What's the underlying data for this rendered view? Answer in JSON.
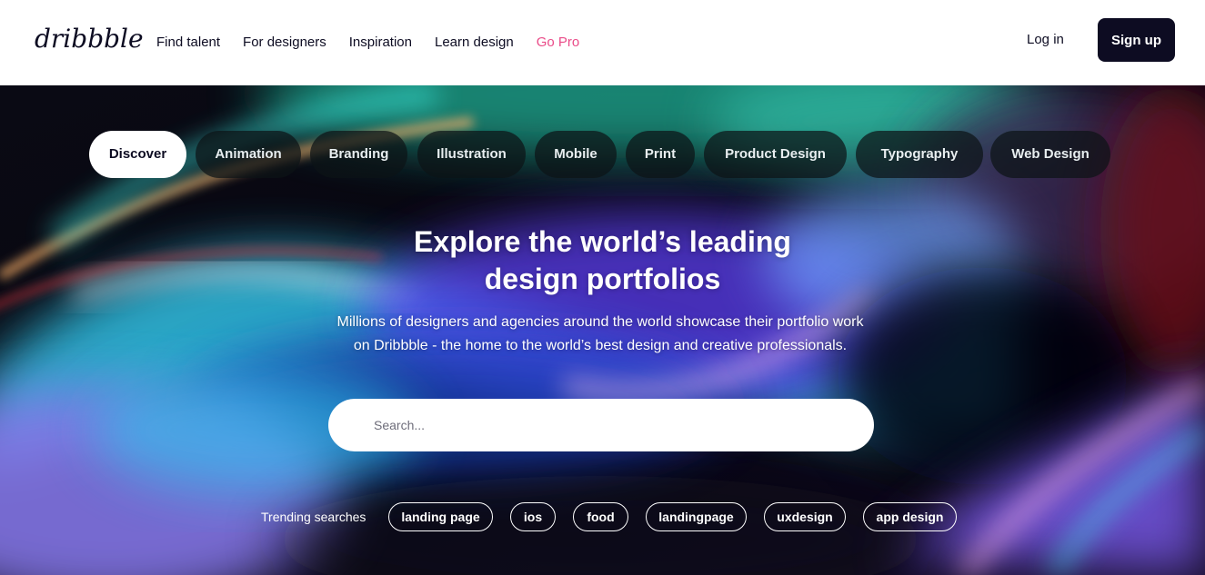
{
  "header": {
    "logo": "dribbble",
    "nav": [
      "Find talent",
      "For designers",
      "Inspiration",
      "Learn design",
      "Go Pro"
    ],
    "login_label": "Log in",
    "signup_label": "Sign up"
  },
  "hero": {
    "categories": [
      "Discover",
      "Animation",
      "Branding",
      "Illustration",
      "Mobile",
      "Print",
      "Product Design",
      "Typography",
      "Web Design"
    ],
    "active_category": "Discover",
    "headline_line1": "Explore the world’s leading",
    "headline_line2": "design portfolios",
    "subtext_line1": "Millions of designers and agencies around the world showcase their portfolio work",
    "subtext_line2": "on Dribbble - the home to the world’s best design and creative professionals.",
    "search_placeholder": "Search...",
    "trending_label": "Trending searches",
    "trending": [
      "landing page",
      "ios",
      "food",
      "landingpage",
      "uxdesign",
      "app design"
    ]
  },
  "colors": {
    "brand_dark": "#0d0c22",
    "pro_pink": "#ea4c89",
    "white": "#ffffff"
  }
}
